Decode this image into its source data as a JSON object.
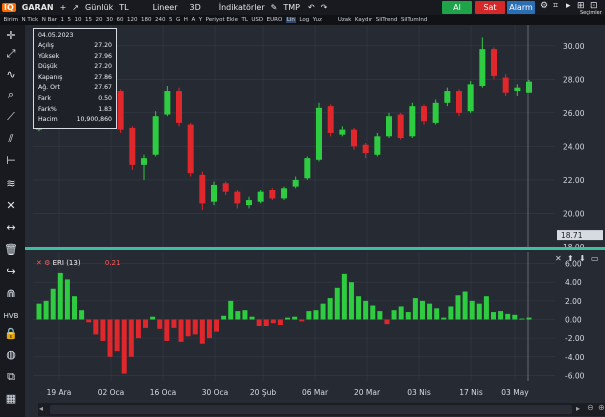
{
  "toolbar": {
    "logo": "IQ",
    "symbol": "GARAN",
    "plus": "+",
    "period": "Günlük",
    "currency": "TL",
    "scale": "Lineer",
    "view3d": "3D",
    "indicators": "İndikatörler",
    "tmp": "TMP",
    "buy": "Al",
    "sell": "Sat",
    "alarm": "Alarm"
  },
  "toolbar2": {
    "items": [
      "Birim",
      "N Tick",
      "N Bar",
      "1",
      "5",
      "10",
      "15",
      "20",
      "30",
      "60",
      "120",
      "180",
      "240",
      "5",
      "G",
      "H",
      "A",
      "Y",
      "Periyot Ekle",
      "TL",
      "USD",
      "EURO",
      "Lin",
      "Log",
      "Yuz",
      "Uzak",
      "Kaydır",
      "SilTrend",
      "SilTumInd"
    ],
    "active_index": 22
  },
  "infobox": {
    "date": "04.05.2023",
    "rows": [
      {
        "label": "Açılış",
        "value": "27.20"
      },
      {
        "label": "Yüksek",
        "value": "27.96"
      },
      {
        "label": "Düşük",
        "value": "27.20"
      },
      {
        "label": "Kapanış",
        "value": "27.86"
      },
      {
        "label": "Ağ. Ort",
        "value": "27.67"
      },
      {
        "label": "Fark",
        "value": "0.50"
      },
      {
        "label": "Fark%",
        "value": "1.83"
      },
      {
        "label": "Hacim",
        "value": "10,900,860"
      }
    ]
  },
  "right_panel_label": "Seçimler",
  "price_axis": {
    "ticks": [
      "30.00",
      "28.00",
      "26.00",
      "24.00",
      "22.00",
      "20.00",
      "18.00"
    ],
    "current_price_label": "18.71",
    "current_price_value": 18.71
  },
  "eri": {
    "name": "ERI (13)",
    "value": "0.21",
    "ticks": [
      "6.00",
      "4.00",
      "2.00",
      "0.00",
      "-2.00",
      "-4.00",
      "-6.00"
    ]
  },
  "date_labels": [
    "19 Ara",
    "02 Oca",
    "16 Oca",
    "30 Oca",
    "20 Şub",
    "06 Mar",
    "20 Mar",
    "03 Nis",
    "17 Nis",
    "03 May"
  ],
  "colors": {
    "up": "#2ecc40",
    "down": "#e0272c",
    "buy": "#1ea34a",
    "sell": "#d62828",
    "alarm": "#2a6fb5"
  },
  "chart_data": [
    {
      "type": "candlestick",
      "title": "GARAN",
      "ylim": [
        18,
        31
      ],
      "grid": true,
      "x": [
        "19 Ara",
        "02 Oca",
        "16 Oca",
        "30 Oca",
        "20 Şub",
        "06 Mar",
        "20 Mar",
        "03 Nis",
        "17 Nis",
        "03 May"
      ],
      "close": [
        25.5,
        28.6,
        27.7,
        27.5,
        25.8,
        27.2,
        27.3,
        25.0,
        22.9,
        23.3,
        25.8,
        27.3,
        25.4,
        22.4,
        20.6,
        21.7,
        21.3,
        20.6,
        20.8,
        21.3,
        20.9,
        21.5,
        22.0,
        23.3,
        26.3,
        24.8,
        25.0,
        24.0,
        23.6,
        24.6,
        25.8,
        24.5,
        26.4,
        25.5,
        26.6,
        27.3,
        26.0,
        27.7,
        29.8,
        28.2,
        27.2,
        27.5,
        27.86
      ],
      "open": [
        25.0,
        25.6,
        28.4,
        27.8,
        27.6,
        25.9,
        27.0,
        27.3,
        25.1,
        22.9,
        23.5,
        25.9,
        27.3,
        25.3,
        22.3,
        20.7,
        21.8,
        21.3,
        20.5,
        20.7,
        21.4,
        20.9,
        21.6,
        22.1,
        23.2,
        26.4,
        24.7,
        25.0,
        24.1,
        23.5,
        24.6,
        25.9,
        24.6,
        26.4,
        25.4,
        26.6,
        27.3,
        26.1,
        27.6,
        29.8,
        28.1,
        27.3,
        27.2
      ],
      "high": [
        26.0,
        28.9,
        28.6,
        28.0,
        27.7,
        27.4,
        27.6,
        27.4,
        25.2,
        23.5,
        26.1,
        27.6,
        27.5,
        25.4,
        22.5,
        21.9,
        21.9,
        21.4,
        21.0,
        21.4,
        21.5,
        21.6,
        22.2,
        23.4,
        26.6,
        26.5,
        25.2,
        25.1,
        24.2,
        24.8,
        26.0,
        26.0,
        26.6,
        26.5,
        26.8,
        27.5,
        27.4,
        27.9,
        30.5,
        29.9,
        28.3,
        27.7,
        27.96
      ],
      "low": [
        24.9,
        25.5,
        27.5,
        27.3,
        25.6,
        25.8,
        26.8,
        24.8,
        22.6,
        22.0,
        23.4,
        25.8,
        25.2,
        22.2,
        20.2,
        20.5,
        21.1,
        20.3,
        20.3,
        20.6,
        20.8,
        20.8,
        21.5,
        22.0,
        23.1,
        24.6,
        24.6,
        23.8,
        23.3,
        23.4,
        24.5,
        24.4,
        24.5,
        25.3,
        25.3,
        26.4,
        25.8,
        26.0,
        27.5,
        28.0,
        27.0,
        27.0,
        27.2
      ]
    },
    {
      "type": "bar",
      "title": "ERI (13)",
      "ylim": [
        -6.6,
        6.6
      ],
      "values": [
        1.7,
        2.0,
        3.3,
        5.0,
        4.3,
        2.5,
        1.0,
        -0.3,
        -1.6,
        -2.3,
        -4.0,
        -3.4,
        -5.8,
        -4.0,
        -2.0,
        -0.9,
        0.3,
        -1.0,
        -2.3,
        -0.9,
        -2.4,
        -1.8,
        -1.6,
        -2.6,
        -2.0,
        -1.3,
        0.4,
        2.0,
        0.9,
        1.0,
        0.3,
        -0.7,
        -0.7,
        -0.4,
        -0.6,
        0.2,
        0.3,
        -0.2,
        0.9,
        1.0,
        1.7,
        2.3,
        3.4,
        4.9,
        4.0,
        2.5,
        2.0,
        1.5,
        0.9,
        -0.5,
        1.0,
        1.4,
        0.8,
        2.3,
        2.0,
        1.7,
        1.2,
        0.2,
        1.4,
        2.6,
        3.0,
        2.0,
        1.7,
        2.5,
        0.8,
        0.9,
        0.6,
        0.5,
        0.1,
        0.2
      ],
      "colors_rule": "green if > 0, red if < 0"
    }
  ]
}
